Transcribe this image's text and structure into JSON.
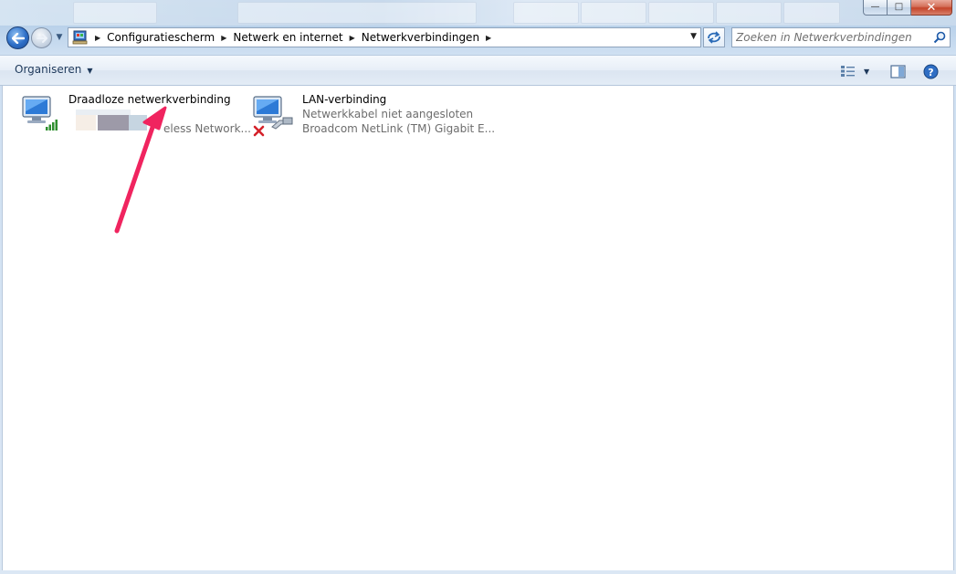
{
  "window": {
    "controls": {
      "minimize": "—",
      "maximize": "□",
      "close": "✕"
    }
  },
  "navbar": {
    "breadcrumbs": [
      "Configuratiescherm",
      "Netwerk en internet",
      "Netwerkverbindingen"
    ],
    "search_placeholder": "Zoeken in Netwerkverbindingen"
  },
  "toolbar": {
    "organize_label": "Organiseren",
    "organize_caret": "▼",
    "views_caret": "▼"
  },
  "connections": [
    {
      "title": "Draadloze netwerkverbinding",
      "line2": "",
      "line3": "eless Network..."
    },
    {
      "title": "LAN-verbinding",
      "line2": "Netwerkkabel niet aangesloten",
      "line3": "Broadcom NetLink (TM) Gigabit E..."
    }
  ],
  "colors": {
    "annotation_arrow": "#f0245f",
    "disconnected_x": "#d4212a",
    "signal_bars": "#2f8f2f"
  }
}
